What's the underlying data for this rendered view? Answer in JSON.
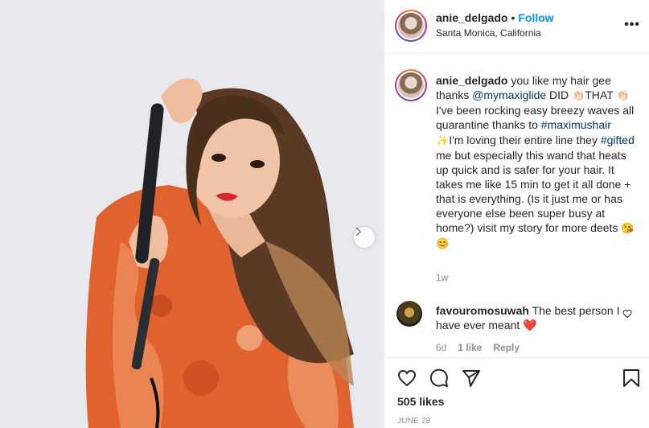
{
  "post": {
    "username": "anie_delgado",
    "separator": "•",
    "follow_label": "Follow",
    "location": "Santa Monica, California",
    "more_label": "•••"
  },
  "caption": {
    "username": "anie_delgado",
    "segments": [
      {
        "text": " you like my hair gee thanks ",
        "type": "text"
      },
      {
        "text": "@mymaxiglide",
        "type": "link"
      },
      {
        "text": " DID ",
        "type": "text"
      },
      {
        "text": "👏🏻",
        "type": "emoji"
      },
      {
        "text": "THAT ",
        "type": "text"
      },
      {
        "text": "👏🏻",
        "type": "emoji"
      },
      {
        "text": "I've been rocking easy breezy waves all quarantine thanks to ",
        "type": "text"
      },
      {
        "text": "#maximushair",
        "type": "link"
      },
      {
        "text": " ✨",
        "type": "emoji"
      },
      {
        "text": "I'm loving their entire line they ",
        "type": "text"
      },
      {
        "text": "#gifted",
        "type": "link"
      },
      {
        "text": " me but especially this wand that heats up quick and is safer for your hair. It takes me like 15 min to get it all done + that is everything. (Is it just me or has everyone else been super busy at home?) visit my story for more deets ",
        "type": "text"
      },
      {
        "text": "😘😊",
        "type": "emoji"
      }
    ],
    "time": "1w"
  },
  "comment": {
    "username": "favouromosuwah",
    "text": " The best person I have ever meant ",
    "emoji": "❤️",
    "time": "6d",
    "likes": "1 like",
    "reply_label": "Reply"
  },
  "footer": {
    "likes": "505 likes",
    "date": "JUNE 28"
  },
  "icons": {
    "like": "heart-icon",
    "comment": "comment-icon",
    "share": "send-icon",
    "save": "bookmark-icon",
    "next": "chevron-right-icon",
    "comment_like": "heart-outline-icon"
  },
  "colors": {
    "link": "#00376b",
    "follow": "#0095f6",
    "muted": "#8e8e8e",
    "text": "#262626"
  }
}
